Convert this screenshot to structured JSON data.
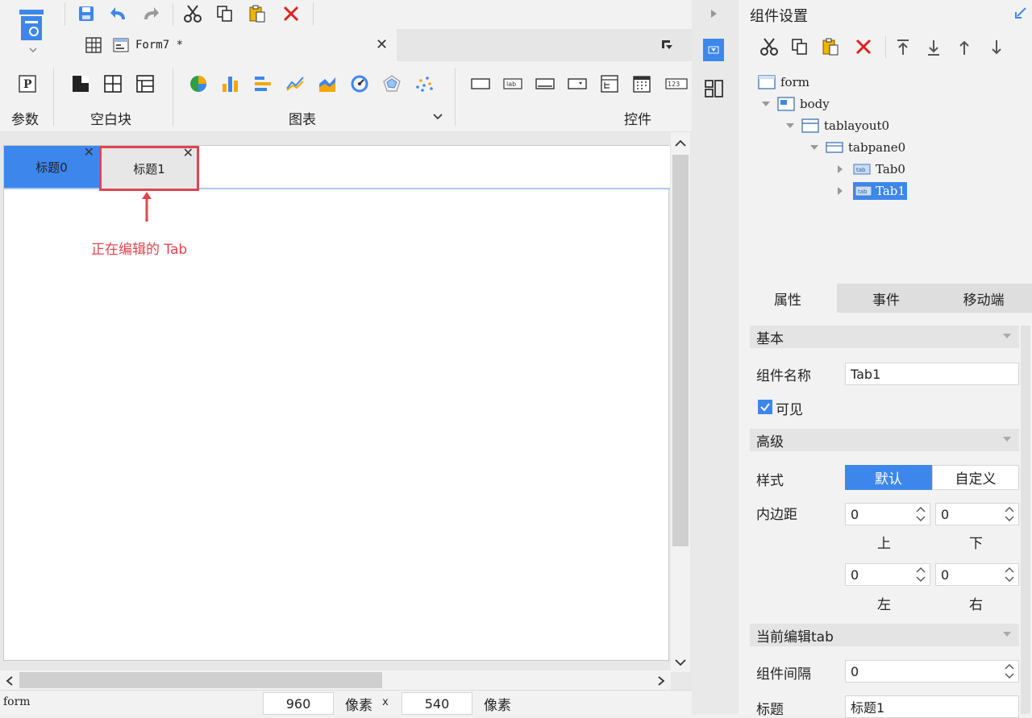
{
  "doc_tab": {
    "name": "Form7 *"
  },
  "ribbon": {
    "groups": [
      {
        "label": "参数"
      },
      {
        "label": "空白块"
      },
      {
        "label": "图表"
      },
      {
        "label": "控件"
      }
    ]
  },
  "canvas": {
    "tabs": [
      {
        "label": "标题0",
        "active": false
      },
      {
        "label": "标题1",
        "active": true
      }
    ],
    "annotation": "正在编辑的 Tab"
  },
  "status": {
    "selected": "form",
    "width": "960",
    "unit1": "像素",
    "x": "x",
    "height": "540",
    "unit2": "像素"
  },
  "right_panel": {
    "title": "组件设置",
    "tree": [
      {
        "label": "form",
        "level": 0
      },
      {
        "label": "body",
        "level": 1
      },
      {
        "label": "tablayout0",
        "level": 2
      },
      {
        "label": "tabpane0",
        "level": 3
      },
      {
        "label": "Tab0",
        "level": 4
      },
      {
        "label": "Tab1",
        "level": 4,
        "selected": true
      }
    ],
    "tabs": [
      "属性",
      "事件",
      "移动端"
    ],
    "section_basic": "基本",
    "name_label": "组件名称",
    "name_value": "Tab1",
    "visible_label": "可见",
    "section_advanced": "高级",
    "style_label": "样式",
    "style_default": "默认",
    "style_custom": "自定义",
    "padding_label": "内边距",
    "padding": {
      "top": "0",
      "bottom": "0",
      "left": "0",
      "right": "0"
    },
    "padding_top_label": "上",
    "padding_bottom_label": "下",
    "padding_left_label": "左",
    "padding_right_label": "右",
    "section_current_tab": "当前编辑tab",
    "gap_label": "组件间隔",
    "gap_value": "0",
    "title_label": "标题",
    "title_value": "标题1"
  },
  "colors": {
    "accent": "#3d87ec",
    "highlight": "#e0454f",
    "selected_tree": "#3d87ec"
  }
}
